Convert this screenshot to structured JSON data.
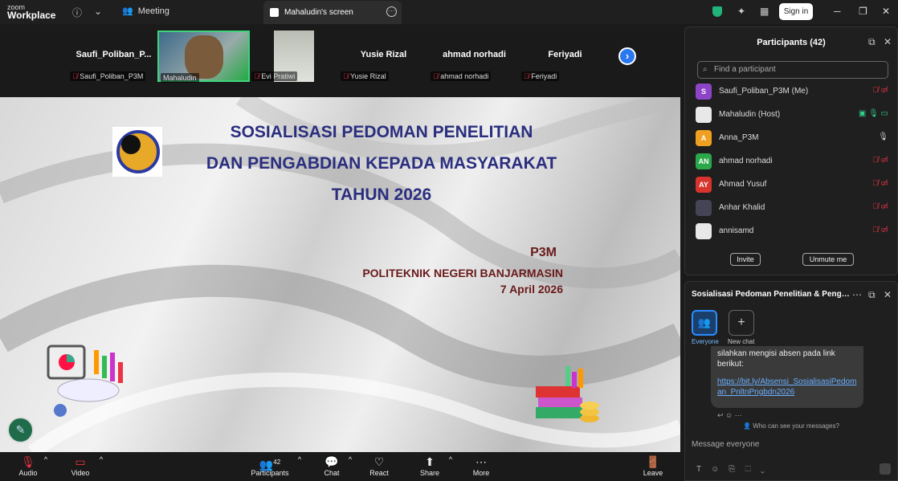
{
  "titlebar": {
    "logo_line1": "zoom",
    "logo_line2": "Workplace",
    "meeting_label": "Meeting",
    "screen_tab": "Mahaludin's screen",
    "sign_in": "Sign in"
  },
  "strip": {
    "tiles": [
      {
        "name": "Saufi_Poliban_P...",
        "label": "Saufi_Poliban_P3M"
      },
      {
        "name": "",
        "label": "Mahaludin"
      },
      {
        "name": "",
        "label": "Evi Pratiwi"
      },
      {
        "name": "Yusie Rizal",
        "label": "Yusie Rizal"
      },
      {
        "name": "ahmad norhadi",
        "label": "ahmad norhadi"
      },
      {
        "name": "Feriyadi",
        "label": "Feriyadi"
      }
    ]
  },
  "slide": {
    "title_line1": "SOSIALISASI PEDOMAN PENELITIAN",
    "title_line2": "DAN PENGABDIAN KEPADA MASYARAKAT",
    "title_line3": "TAHUN 2026",
    "unit": "P3M",
    "institution": "POLITEKNIK NEGERI BANJARMASIN",
    "date": "7 April 2026",
    "seal_text": "POLITEKNIK NEGERI BANJARMASIN"
  },
  "bottombar": {
    "audio": "Audio",
    "video": "Video",
    "participants": "Participants",
    "participants_count": "42",
    "chat": "Chat",
    "react": "React",
    "share": "Share",
    "more": "More",
    "leave": "Leave"
  },
  "participants_panel": {
    "title": "Participants (42)",
    "search_placeholder": "Find a participant",
    "list": [
      {
        "initials": "S",
        "name": "Saufi_Poliban_P3M (Me)",
        "color": "#8e44c8"
      },
      {
        "initials": "",
        "name": "Mahaludin (Host)",
        "color": "#e8e8e8"
      },
      {
        "initials": "A",
        "name": "Anna_P3M",
        "color": "#f0a020"
      },
      {
        "initials": "AN",
        "name": "ahmad norhadi",
        "color": "#2aa84a"
      },
      {
        "initials": "AY",
        "name": "Ahmad Yusuf",
        "color": "#d6342c"
      },
      {
        "initials": "",
        "name": "Anhar Khalid",
        "color": "#445"
      },
      {
        "initials": "",
        "name": "annisamd",
        "color": "#e8e8e8"
      }
    ],
    "invite": "Invite",
    "unmute_me": "Unmute me"
  },
  "chat_panel": {
    "title": "Sosialisasi Pedoman Penelitian & Pengabd...",
    "everyone": "Everyone",
    "new_chat": "New chat",
    "message_text": "silahkan mengisi absen pada link berikut:",
    "message_link": "https://bit.ly/Absensi_SosialisasiPedoman_PnltnPngbdn2026",
    "who_can_see": "Who can see your messages?",
    "input_placeholder": "Message everyone"
  },
  "colors": {
    "accent": "#2d8cff",
    "title_blue": "#2a2e7e",
    "title_maroon": "#6a1a1a",
    "muted_red": "#e34"
  }
}
